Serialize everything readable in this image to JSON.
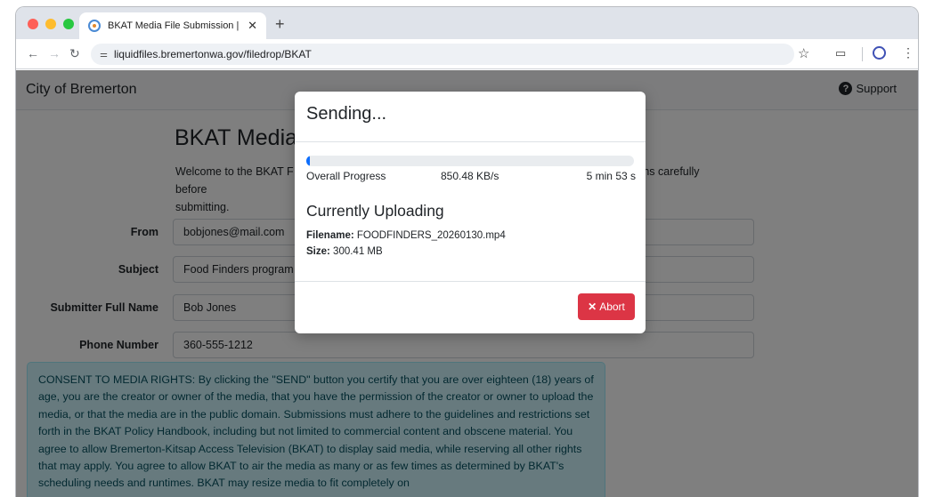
{
  "browser": {
    "tab_title": "BKAT Media File Submission |",
    "tab_close_icon": "close-icon",
    "url": "liquidfiles.bremertonwa.gov/filedrop/BKAT"
  },
  "site": {
    "brand": "City of Bremerton",
    "support_label": "Support"
  },
  "page": {
    "title": "BKAT Media",
    "welcome_lines": [
      "Welcome to the BKAT F",
      "submitting."
    ],
    "welcome_tail": "rms carefully before"
  },
  "form": {
    "fields": [
      {
        "label": "From",
        "value": "bobjones@mail.com"
      },
      {
        "label": "Subject",
        "value": "Food Finders program"
      },
      {
        "label": "Submitter Full Name",
        "value": "Bob Jones"
      },
      {
        "label": "Phone Number",
        "value": "360-555-1212"
      }
    ]
  },
  "consent_text": "CONSENT TO MEDIA RIGHTS: By clicking the \"SEND\" button you certify that you are over eighteen (18) years of age, you are the creator or owner of the media, that you have the permission of the creator or owner to upload the media, or that the media are in the public domain. Submissions must adhere to the guidelines and restrictions set forth in the BKAT Policy Handbook, including but not limited to commercial content and obscene material. You agree to allow Bremerton-Kitsap Access Television (BKAT) to display said media, while reserving all other rights that may apply. You agree to allow BKAT to air the media as many or as few times as determined by BKAT's scheduling needs and runtimes. BKAT may resize media to fit completely on",
  "modal": {
    "title": "Sending...",
    "progress_fraction": 0.012,
    "progress_label": "Overall Progress",
    "speed": "850.48 KB/s",
    "remaining": "5 min 53 s",
    "uploading_title": "Currently Uploading",
    "filename_label": "Filename:",
    "filename": "FOODFINDERS_20260130.mp4",
    "size_label": "Size:",
    "size": "300.41 MB",
    "abort_label": "Abort"
  },
  "colors": {
    "progress": "#0d6efd",
    "abort": "#dc3545",
    "consent_bg": "#cff4fc"
  }
}
